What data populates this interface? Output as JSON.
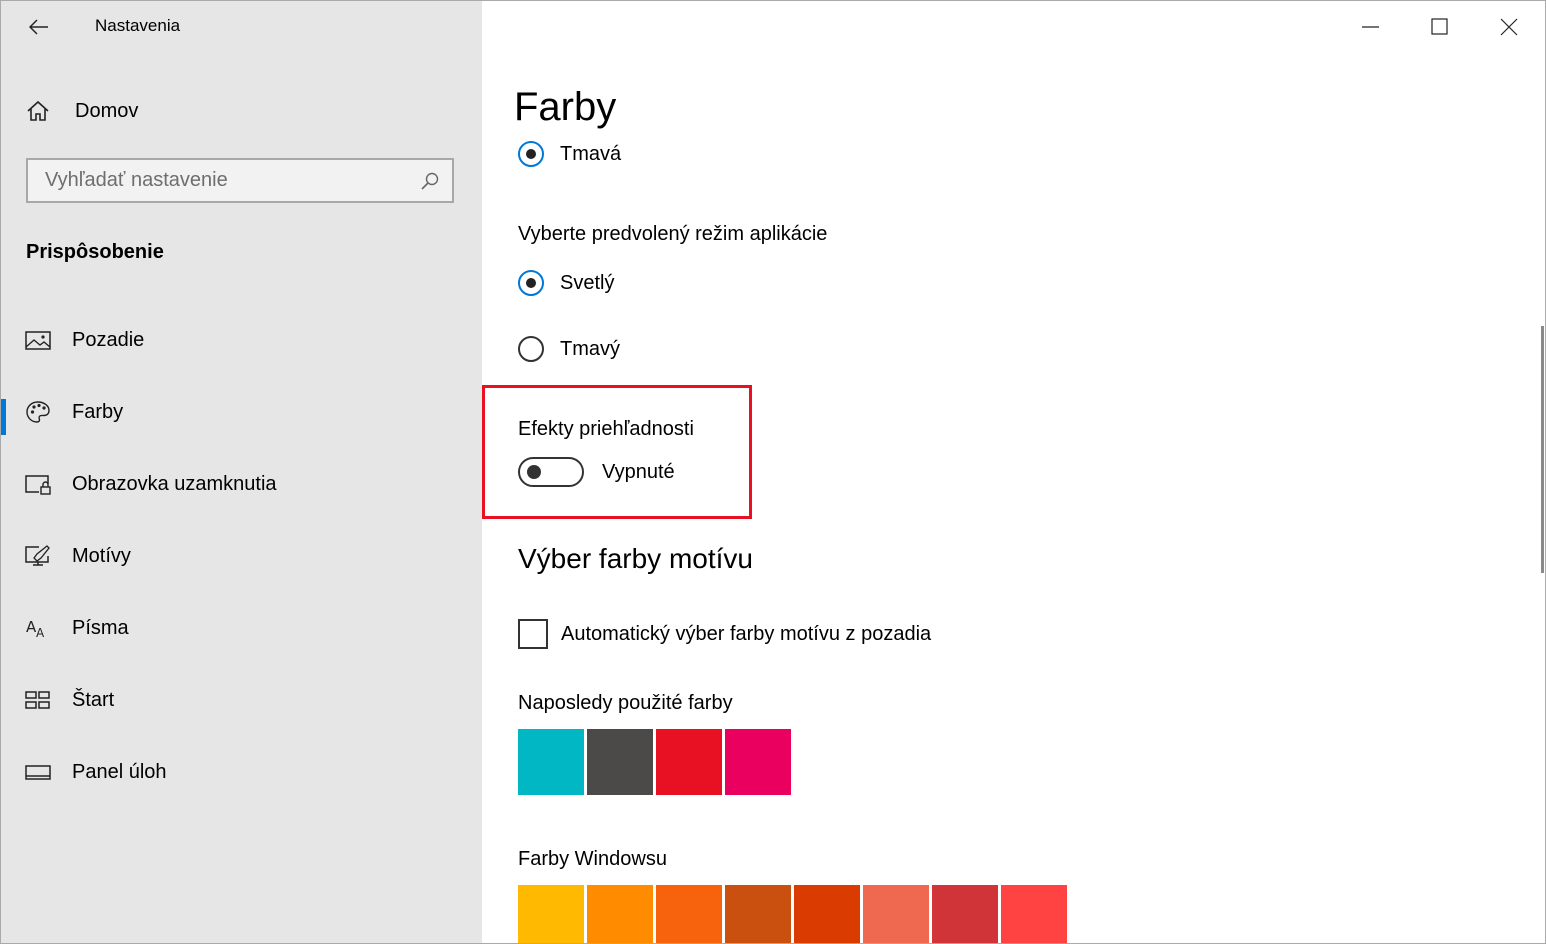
{
  "window": {
    "title": "Nastavenia",
    "controls": [
      "minimize-icon",
      "maximize-icon",
      "close-icon"
    ]
  },
  "sidebar": {
    "home_label": "Domov",
    "search_placeholder": "Vyhľadať nastavenie",
    "section_title": "Prispôsobenie",
    "items": [
      {
        "label": "Pozadie",
        "icon": "picture-icon"
      },
      {
        "label": "Farby",
        "icon": "palette-icon",
        "selected": true
      },
      {
        "label": "Obrazovka uzamknutia",
        "icon": "lock-screen-icon"
      },
      {
        "label": "Motívy",
        "icon": "themes-icon"
      },
      {
        "label": "Písma",
        "icon": "fonts-icon"
      },
      {
        "label": "Štart",
        "icon": "start-icon"
      },
      {
        "label": "Panel úloh",
        "icon": "taskbar-icon"
      }
    ],
    "accent_color": "#0078d7"
  },
  "main": {
    "title": "Farby",
    "windows_mode_option": {
      "label": "Tmavá",
      "selected": true
    },
    "app_mode": {
      "heading": "Vyberte predvolený režim aplikácie",
      "options": [
        {
          "label": "Svetlý",
          "selected": true
        },
        {
          "label": "Tmavý",
          "selected": false
        }
      ]
    },
    "transparency": {
      "heading": "Efekty priehľadnosti",
      "state": "Vypnuté",
      "on": false,
      "highlight_color": "#e81123"
    },
    "accent_section": {
      "heading": "Výber farby motívu",
      "auto_checkbox": {
        "label": "Automatický výber farby motívu z pozadia",
        "checked": false
      },
      "recent_heading": "Naposledy použité farby",
      "recent_colors": [
        "#00b7c3",
        "#4c4a48",
        "#e81123",
        "#ea005e"
      ],
      "windows_heading": "Farby Windowsu",
      "windows_colors": [
        "#ffb900",
        "#ff8c00",
        "#f7630c",
        "#ca5010",
        "#da3b01",
        "#ef6950",
        "#d13438",
        "#ff4343"
      ]
    }
  }
}
